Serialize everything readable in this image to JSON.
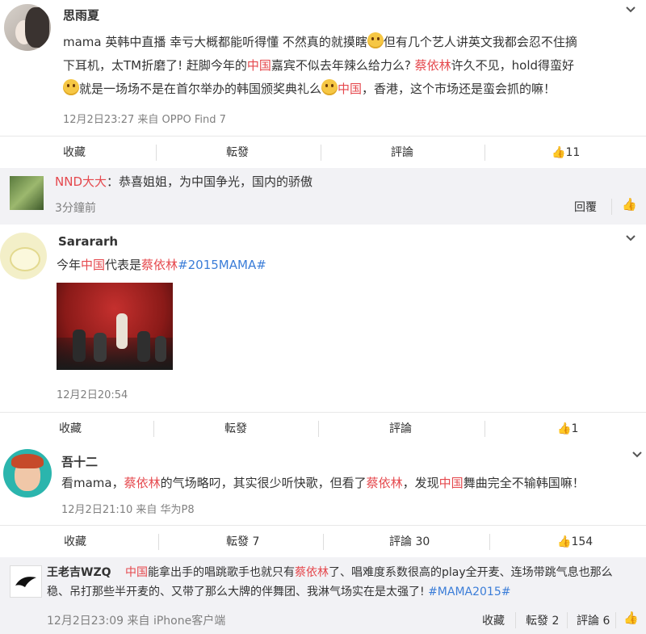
{
  "posts": [
    {
      "username": "思雨夏",
      "text_1": "mama 英韩中直播 幸亏大概都能听得懂 不然真的就摸瞎",
      "text_2": "但有几个艺人讲英文我都会忍不住摘",
      "text_3": "下耳机，太TM折磨了! 赶脚今年的",
      "text_3_hl": "中国",
      "text_4": "嘉宾不似去年辣么给力么? ",
      "text_4_hl": "蔡依林",
      "text_5": "许久不见，hold得蛮好",
      "text_6": "就是一场场不是在首尔举办的韩国颁奖典礼么",
      "text_6_hl": "中国",
      "text_7": "，香港，这个市场还是蛮会抓的嘛！",
      "meta": "12月2日23:27 来自 OPPO Find 7",
      "actions": {
        "fav": "收藏",
        "repost": "転發",
        "comment": "評論",
        "like": "11"
      }
    },
    {
      "reply_user": "NND大大",
      "reply_text": "：恭喜姐姐，为中国争光，国内的骄傲",
      "reply_time": "3分鐘前",
      "reply_action": "回覆"
    },
    {
      "username": "Sarararh",
      "text_a": "今年",
      "text_hl1": "中国",
      "text_b": "代表是",
      "text_hl2": "蔡依林",
      "text_tag": "#2015MAMA#",
      "meta": "12月2日20:54",
      "actions": {
        "fav": "收藏",
        "repost": "転發",
        "comment": "評論",
        "like": "1"
      }
    },
    {
      "username": "吾十二",
      "text_a": "看mama，",
      "text_hl1": "蔡依林",
      "text_b": "的气场略叼，其实很少听快歌，但看了",
      "text_hl2": "蔡依林",
      "text_c": "，发现",
      "text_hl3": "中国",
      "text_d": "舞曲完全不输韩国嘛！",
      "meta": "12月2日21:10 来自 华为P8",
      "actions": {
        "fav": "收藏",
        "repost": "転發 7",
        "comment": "評論 30",
        "like": "154"
      }
    },
    {
      "username": "王老吉WZQ",
      "text_hl1": "中国",
      "text_a": "能拿出手的唱跳歌手也就只有",
      "text_hl2": "蔡依林",
      "text_b": "了、唱难度系数很高的play全开麦、连场带跳气息也那么",
      "text_c": "稳、吊打那些半开麦的、又带了那么大牌的伴舞团、我淋气场实在是太强了! ",
      "text_tag": "#MAMA2015#",
      "meta": "12月2日23:09 来自 iPhone客户端",
      "actions": {
        "fav": "收藏",
        "repost": "転發 2",
        "comment": "評論 6"
      }
    }
  ],
  "colors": {
    "highlight": "#e5484d",
    "tag": "#3b7dd8"
  }
}
